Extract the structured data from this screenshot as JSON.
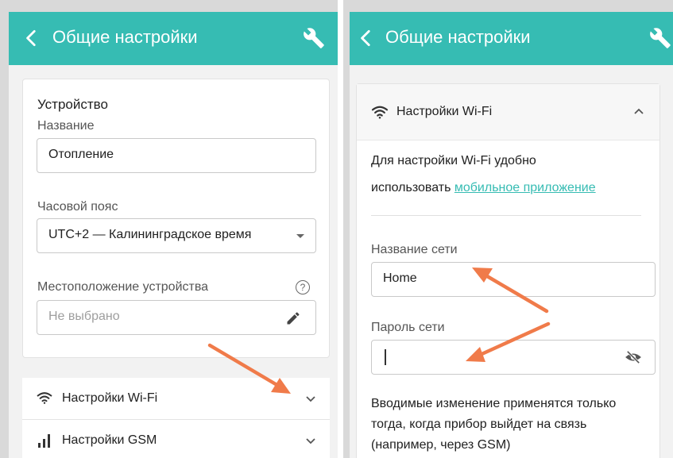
{
  "left_screen": {
    "header": {
      "title": "Общие настройки",
      "back_icon": "chevron-left-icon",
      "tools_icon": "wrench-icon"
    },
    "device_section": {
      "title": "Устройство",
      "name_label": "Название",
      "name_value": "Отопление",
      "timezone_label": "Часовой пояс",
      "timezone_value": "UTC+2 — Калининградское время",
      "location_label": "Местоположение устройства",
      "location_help": "?",
      "location_placeholder": "Не выбрано"
    },
    "accordion": [
      {
        "label": "Настройки Wi-Fi",
        "icon": "wifi-icon",
        "state": "collapsed"
      },
      {
        "label": "Настройки GSM",
        "icon": "signal-bars-icon",
        "state": "collapsed"
      }
    ]
  },
  "right_screen": {
    "header": {
      "title": "Общие настройки",
      "back_icon": "chevron-left-icon",
      "tools_icon": "wrench-icon"
    },
    "wifi_section": {
      "title": "Настройки Wi-Fi",
      "state": "expanded",
      "intro_line1": "Для настройки Wi-Fi удобно",
      "intro_prefix": "использовать",
      "intro_link": "мобильное приложение",
      "network_name_label": "Название сети",
      "network_name_value": "Home",
      "password_label": "Пароль сети",
      "password_value": "",
      "note_line1": "Вводимые изменение применятся только",
      "note_line2": "тогда, когда прибор выйдет на связь",
      "note_line3": "(например, через GSM)"
    }
  },
  "colors": {
    "accent": "#36bcb3",
    "annotation_arrow": "#f07b4a",
    "background": "#f2f2f2",
    "bezel": "#d9d9d9"
  }
}
